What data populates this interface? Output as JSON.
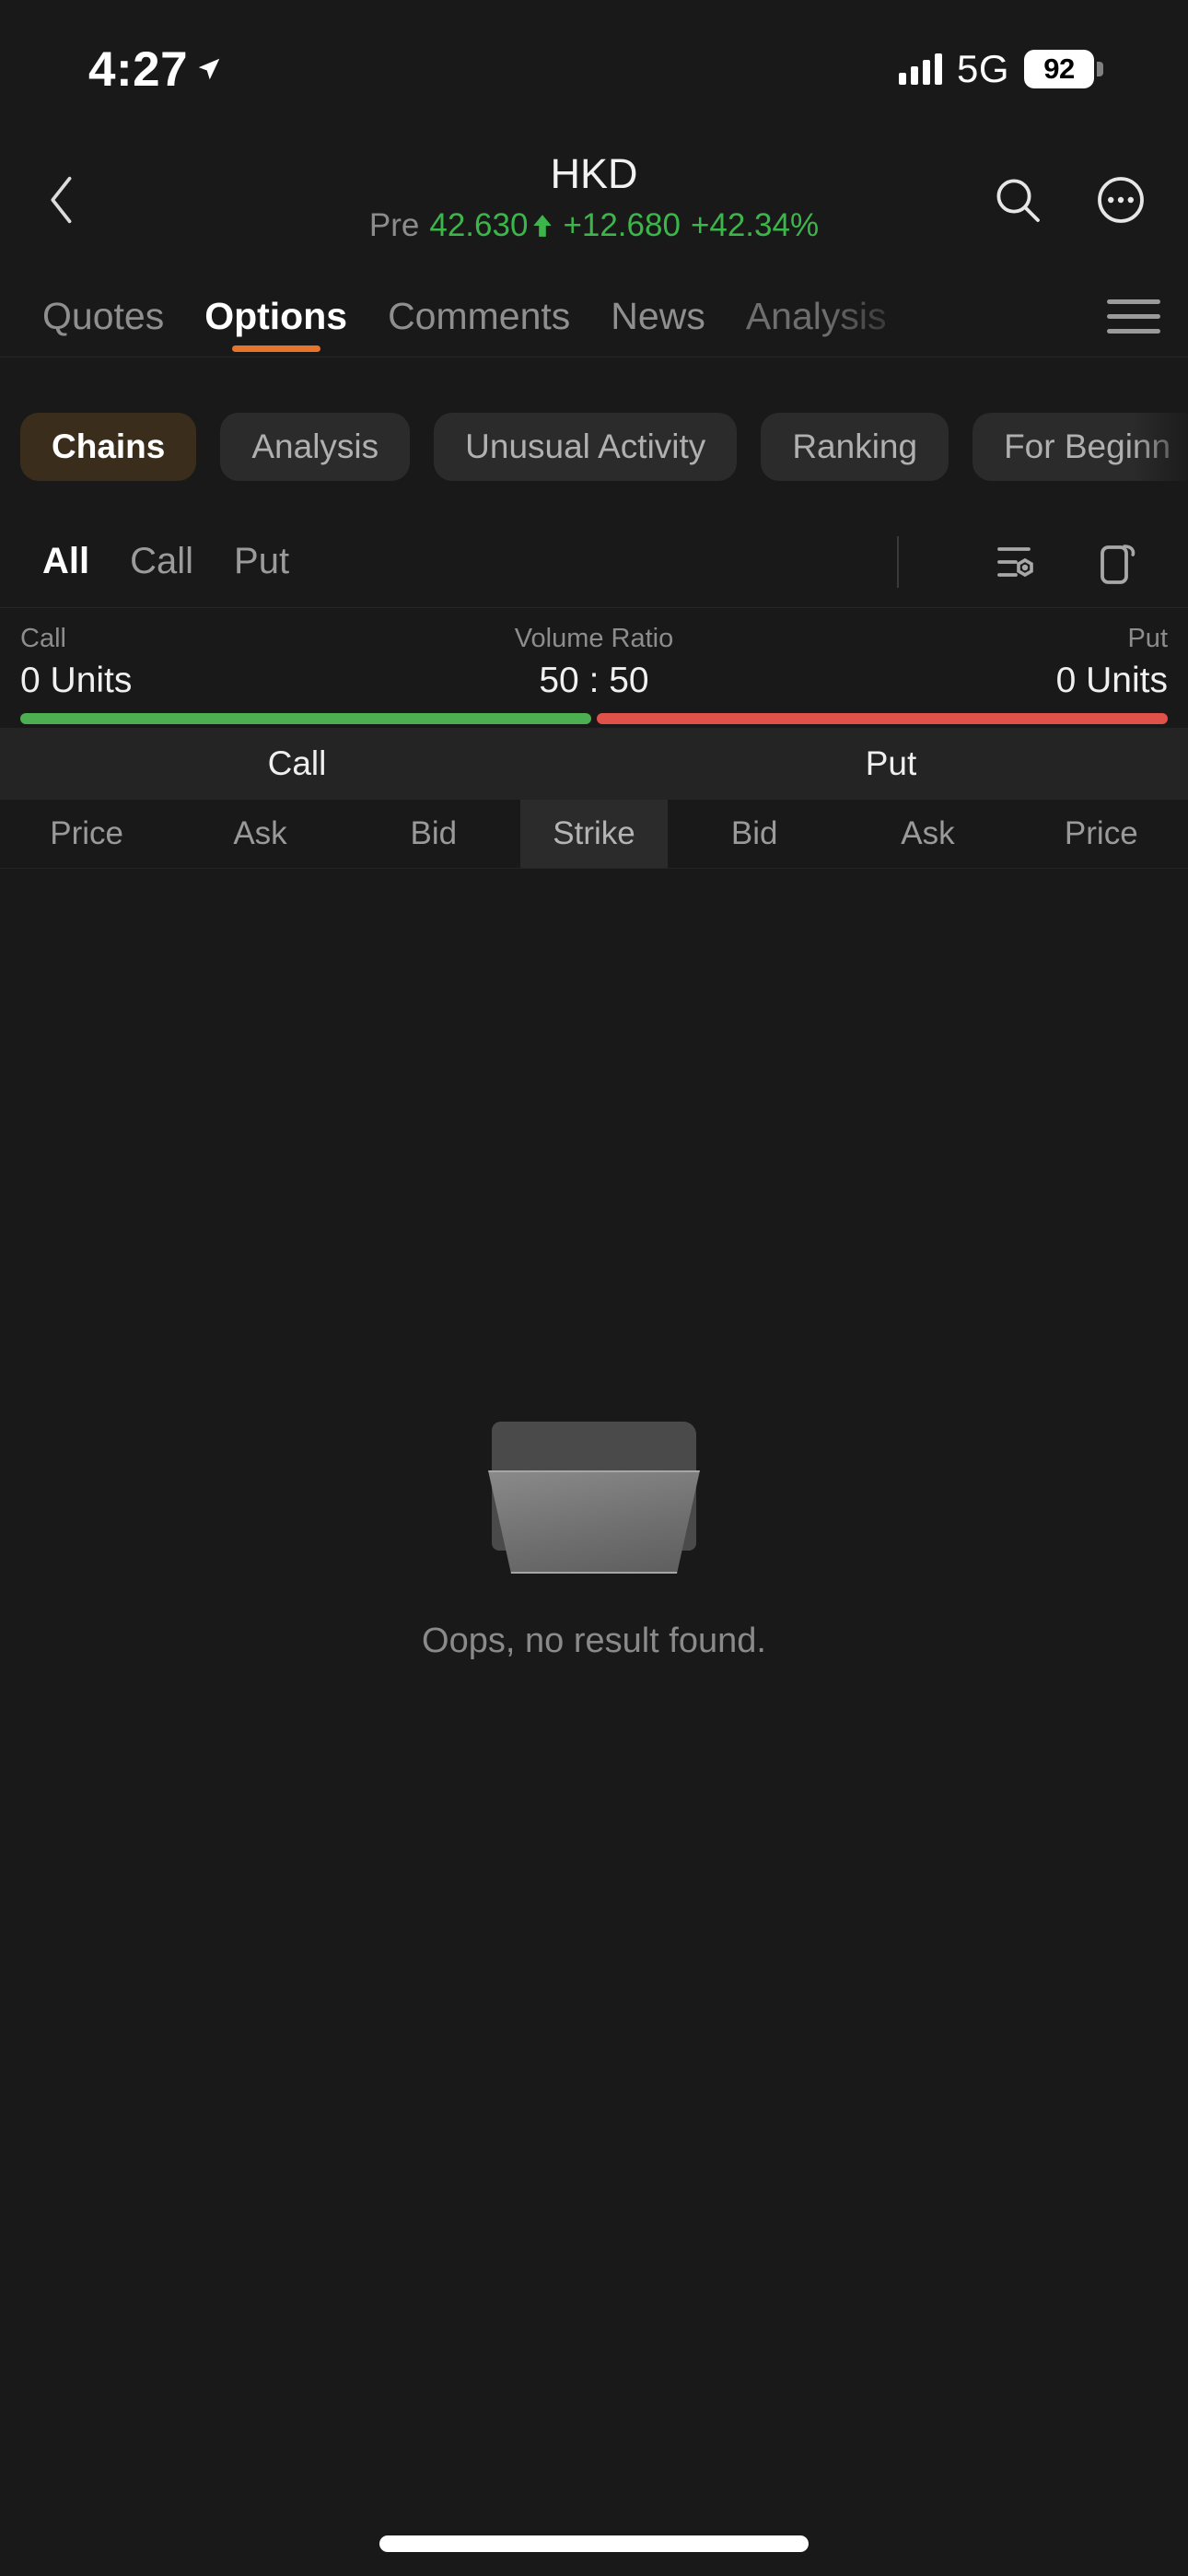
{
  "status_bar": {
    "time": "4:27",
    "location_icon": "location-arrow-icon",
    "signal_icon": "cellular-bars-icon",
    "network": "5G",
    "battery_percent": "92"
  },
  "header": {
    "back_icon": "chevron-left-icon",
    "symbol": "HKD",
    "session_label": "Pre",
    "price": "42.630",
    "direction_icon": "arrow-up-icon",
    "change": "+12.680",
    "change_percent": "+42.34%",
    "change_color": "#3cb54a",
    "search_icon": "search-icon",
    "more_icon": "more-options-icon"
  },
  "main_tabs": {
    "items": [
      {
        "label": "Quotes",
        "active": false
      },
      {
        "label": "Options",
        "active": true
      },
      {
        "label": "Comments",
        "active": false
      },
      {
        "label": "News",
        "active": false
      },
      {
        "label": "Analysis",
        "active": false
      }
    ],
    "active_indicator_color": "#e8732a",
    "menu_icon": "hamburger-menu-icon"
  },
  "sub_tabs": {
    "items": [
      {
        "label": "Chains",
        "active": true
      },
      {
        "label": "Analysis",
        "active": false
      },
      {
        "label": "Unusual Activity",
        "active": false
      },
      {
        "label": "Ranking",
        "active": false
      },
      {
        "label": "For Beginn",
        "active": false
      }
    ],
    "active_bg": "#3b2d1b"
  },
  "filter_row": {
    "options": [
      {
        "label": "All",
        "active": true
      },
      {
        "label": "Call",
        "active": false
      },
      {
        "label": "Put",
        "active": false
      }
    ],
    "settings_icon": "filter-settings-icon",
    "rotate_icon": "rotate-screen-icon"
  },
  "volume_ratio": {
    "call_label": "Call",
    "call_value": "0 Units",
    "center_label": "Volume Ratio",
    "center_value": "50 : 50",
    "put_label": "Put",
    "put_value": "0 Units",
    "call_color": "#4caf50",
    "put_color": "#e0514a",
    "call_pct": 50,
    "put_pct": 50
  },
  "table": {
    "band": {
      "call": "Call",
      "put": "Put"
    },
    "columns": [
      "Price",
      "Ask",
      "Bid",
      "Strike",
      "Bid",
      "Ask",
      "Price"
    ],
    "rows": []
  },
  "empty_state": {
    "icon": "empty-folder-icon",
    "message": "Oops, no result found."
  }
}
